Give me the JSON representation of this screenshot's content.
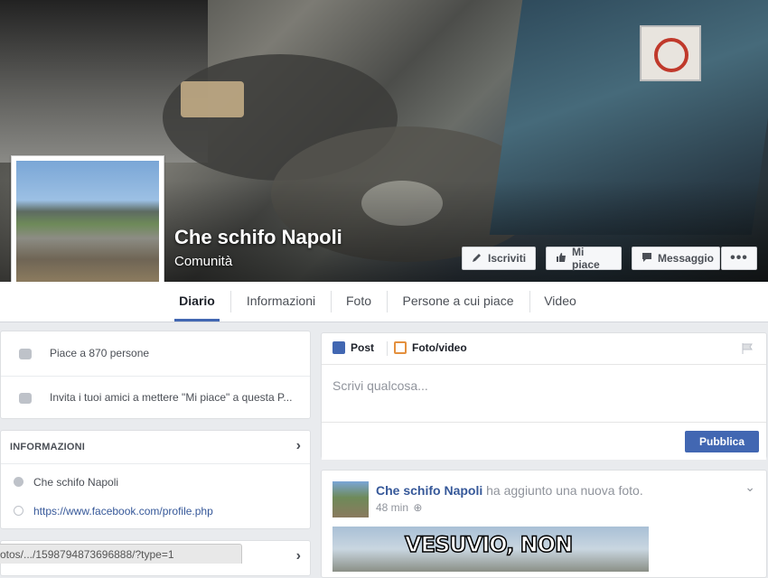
{
  "page": {
    "name": "Che schifo Napoli",
    "category": "Comunità"
  },
  "cover_buttons": {
    "subscribe": "Iscriviti",
    "like": "Mi piace",
    "message": "Messaggio",
    "more": "•••"
  },
  "tabs": [
    {
      "label": "Diario",
      "active": true
    },
    {
      "label": "Informazioni"
    },
    {
      "label": "Foto"
    },
    {
      "label": "Persone a cui piace"
    },
    {
      "label": "Video"
    }
  ],
  "sidebar": {
    "likes_text": "Piace a 870 persone",
    "invite_text": "Invita i tuoi amici a mettere \"Mi piace\" a questa P...",
    "info_header": "INFORMAZIONI",
    "info_name": "Che schifo Napoli",
    "info_url": "https://www.facebook.com/profile.php"
  },
  "composer": {
    "tab_post": "Post",
    "tab_photo": "Foto/video",
    "placeholder": "Scrivi qualcosa...",
    "publish": "Pubblica"
  },
  "post": {
    "author": "Che schifo Napoli",
    "action": "ha aggiunto una nuova foto.",
    "time": "48 min",
    "image_text": "VESUVIO, NON"
  },
  "status_url": "otos/.../1598794873696888/?type=1",
  "colors": {
    "accent": "#4267b2",
    "link": "#365899",
    "background": "#e9ebee"
  }
}
